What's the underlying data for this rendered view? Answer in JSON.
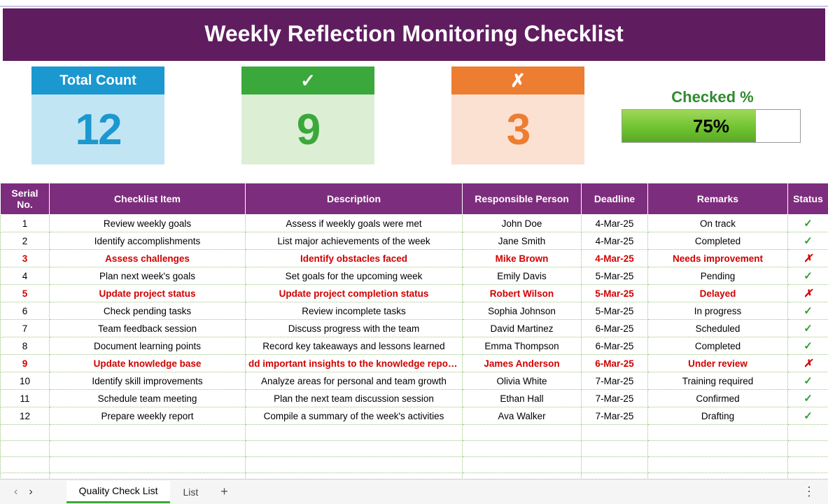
{
  "title": "Weekly Reflection Monitoring Checklist",
  "stats": {
    "total_label": "Total Count",
    "total_value": "12",
    "pass_symbol": "✓",
    "pass_value": "9",
    "fail_symbol": "✗",
    "fail_value": "3"
  },
  "checked": {
    "label": "Checked %",
    "percent_text": "75%",
    "percent_num": 75
  },
  "columns": {
    "serial": "Serial No.",
    "item": "Checklist Item",
    "desc": "Description",
    "person": "Responsible Person",
    "deadline": "Deadline",
    "remarks": "Remarks",
    "status": "Status"
  },
  "rows": [
    {
      "serial": "1",
      "item": "Review weekly goals",
      "desc": "Assess if weekly goals were met",
      "person": "John Doe",
      "deadline": "4-Mar-25",
      "remarks": "On track",
      "status": "pass"
    },
    {
      "serial": "2",
      "item": "Identify accomplishments",
      "desc": "List major achievements of the week",
      "person": "Jane Smith",
      "deadline": "4-Mar-25",
      "remarks": "Completed",
      "status": "pass"
    },
    {
      "serial": "3",
      "item": "Assess challenges",
      "desc": "Identify obstacles faced",
      "person": "Mike Brown",
      "deadline": "4-Mar-25",
      "remarks": "Needs improvement",
      "status": "fail"
    },
    {
      "serial": "4",
      "item": "Plan next week's goals",
      "desc": "Set goals for the upcoming week",
      "person": "Emily Davis",
      "deadline": "5-Mar-25",
      "remarks": "Pending",
      "status": "pass"
    },
    {
      "serial": "5",
      "item": "Update project status",
      "desc": "Update project completion status",
      "person": "Robert Wilson",
      "deadline": "5-Mar-25",
      "remarks": "Delayed",
      "status": "fail"
    },
    {
      "serial": "6",
      "item": "Check pending tasks",
      "desc": "Review incomplete tasks",
      "person": "Sophia Johnson",
      "deadline": "5-Mar-25",
      "remarks": "In progress",
      "status": "pass"
    },
    {
      "serial": "7",
      "item": "Team feedback session",
      "desc": "Discuss progress with the team",
      "person": "David Martinez",
      "deadline": "6-Mar-25",
      "remarks": "Scheduled",
      "status": "pass"
    },
    {
      "serial": "8",
      "item": "Document learning points",
      "desc": "Record key takeaways and lessons learned",
      "person": "Emma Thompson",
      "deadline": "6-Mar-25",
      "remarks": "Completed",
      "status": "pass"
    },
    {
      "serial": "9",
      "item": "Update knowledge base",
      "desc": "dd important insights to the knowledge repositor",
      "person": "James Anderson",
      "deadline": "6-Mar-25",
      "remarks": "Under review",
      "status": "fail"
    },
    {
      "serial": "10",
      "item": "Identify skill improvements",
      "desc": "Analyze areas for personal and team growth",
      "person": "Olivia White",
      "deadline": "7-Mar-25",
      "remarks": "Training required",
      "status": "pass"
    },
    {
      "serial": "11",
      "item": "Schedule team meeting",
      "desc": "Plan the next team discussion session",
      "person": "Ethan Hall",
      "deadline": "7-Mar-25",
      "remarks": "Confirmed",
      "status": "pass"
    },
    {
      "serial": "12",
      "item": "Prepare weekly report",
      "desc": "Compile a summary of the week's activities",
      "person": "Ava Walker",
      "deadline": "7-Mar-25",
      "remarks": "Drafting",
      "status": "pass"
    }
  ],
  "glyphs": {
    "pass": "✓",
    "fail": "✗"
  },
  "tabs": {
    "active": "Quality Check List",
    "other": "List"
  }
}
